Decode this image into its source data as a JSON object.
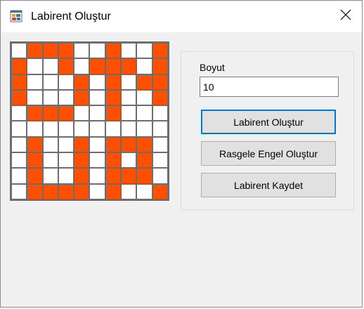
{
  "window": {
    "title": "Labirent Oluştur",
    "icon": "app-form-icon",
    "close_icon": "close-icon"
  },
  "form": {
    "size_label": "Boyut",
    "size_value": "10",
    "buttons": {
      "create": "Labirent Oluştur",
      "random_obstacle": "Rasgele Engel Oluştur",
      "save": "Labirent Kaydet"
    }
  },
  "maze": {
    "rows": 10,
    "cols": 10,
    "wall_color": "#ff4f00",
    "open_color": "#ffffff",
    "border_color": "#6d6d6d",
    "grid": [
      [
        0,
        1,
        1,
        1,
        0,
        0,
        1,
        0,
        0,
        1
      ],
      [
        1,
        0,
        0,
        1,
        0,
        1,
        1,
        1,
        0,
        1
      ],
      [
        1,
        0,
        0,
        0,
        1,
        0,
        1,
        0,
        1,
        1
      ],
      [
        1,
        0,
        0,
        0,
        1,
        0,
        1,
        0,
        0,
        1
      ],
      [
        0,
        1,
        1,
        1,
        0,
        0,
        1,
        0,
        0,
        0
      ],
      [
        0,
        0,
        0,
        0,
        0,
        0,
        0,
        0,
        0,
        0
      ],
      [
        0,
        1,
        0,
        0,
        1,
        0,
        1,
        1,
        1,
        0
      ],
      [
        0,
        1,
        0,
        0,
        1,
        0,
        1,
        0,
        1,
        0
      ],
      [
        0,
        1,
        0,
        0,
        1,
        0,
        1,
        1,
        1,
        0
      ],
      [
        0,
        1,
        1,
        1,
        1,
        0,
        1,
        0,
        0,
        1
      ]
    ]
  }
}
